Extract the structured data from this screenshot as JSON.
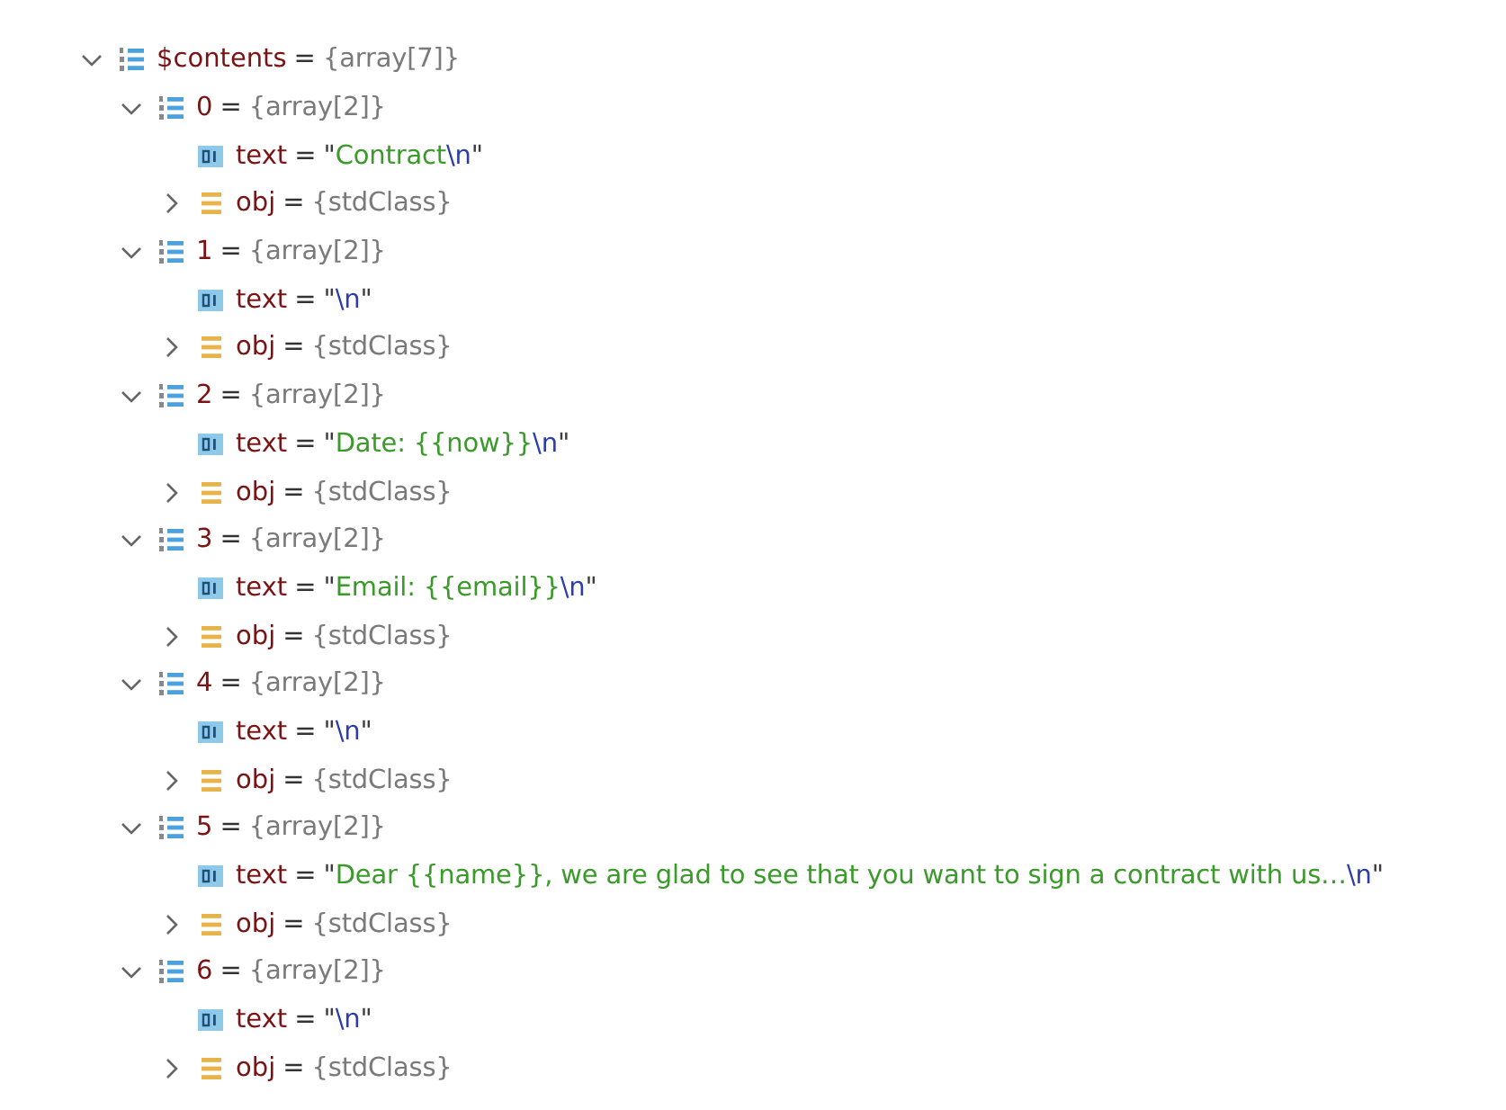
{
  "tree": [
    {
      "name": "$contents",
      "kind": "array",
      "op": "=",
      "expanded": true,
      "value": [
        {
          "kind": "summary",
          "text": "{array[7]}"
        }
      ],
      "children": [
        {
          "name": "0",
          "kind": "array",
          "op": "=",
          "expanded": true,
          "value": [
            {
              "kind": "summary",
              "text": "{array[2]}"
            }
          ],
          "children": [
            {
              "name": "text",
              "kind": "scalar",
              "op": "=",
              "value": [
                {
                  "kind": "quote",
                  "text": "\""
                },
                {
                  "kind": "string",
                  "text": "Contract"
                },
                {
                  "kind": "escape",
                  "text": "\\n"
                },
                {
                  "kind": "quote",
                  "text": "\""
                }
              ]
            },
            {
              "name": "obj",
              "kind": "object",
              "op": "=",
              "expanded": false,
              "value": [
                {
                  "kind": "summary",
                  "text": "{stdClass}"
                }
              ]
            }
          ]
        },
        {
          "name": "1",
          "kind": "array",
          "op": "=",
          "expanded": true,
          "value": [
            {
              "kind": "summary",
              "text": "{array[2]}"
            }
          ],
          "children": [
            {
              "name": "text",
              "kind": "scalar",
              "op": "=",
              "value": [
                {
                  "kind": "quote",
                  "text": "\""
                },
                {
                  "kind": "escape",
                  "text": "\\n"
                },
                {
                  "kind": "quote",
                  "text": "\""
                }
              ]
            },
            {
              "name": "obj",
              "kind": "object",
              "op": "=",
              "expanded": false,
              "value": [
                {
                  "kind": "summary",
                  "text": "{stdClass}"
                }
              ]
            }
          ]
        },
        {
          "name": "2",
          "kind": "array",
          "op": "=",
          "expanded": true,
          "value": [
            {
              "kind": "summary",
              "text": "{array[2]}"
            }
          ],
          "children": [
            {
              "name": "text",
              "kind": "scalar",
              "op": "=",
              "value": [
                {
                  "kind": "quote",
                  "text": "\""
                },
                {
                  "kind": "string",
                  "text": "Date: {{now}}"
                },
                {
                  "kind": "escape",
                  "text": "\\n"
                },
                {
                  "kind": "quote",
                  "text": "\""
                }
              ]
            },
            {
              "name": "obj",
              "kind": "object",
              "op": "=",
              "expanded": false,
              "value": [
                {
                  "kind": "summary",
                  "text": "{stdClass}"
                }
              ]
            }
          ]
        },
        {
          "name": "3",
          "kind": "array",
          "op": "=",
          "expanded": true,
          "value": [
            {
              "kind": "summary",
              "text": "{array[2]}"
            }
          ],
          "children": [
            {
              "name": "text",
              "kind": "scalar",
              "op": "=",
              "value": [
                {
                  "kind": "quote",
                  "text": "\""
                },
                {
                  "kind": "string",
                  "text": "Email: {{email}}"
                },
                {
                  "kind": "escape",
                  "text": "\\n"
                },
                {
                  "kind": "quote",
                  "text": "\""
                }
              ]
            },
            {
              "name": "obj",
              "kind": "object",
              "op": "=",
              "expanded": false,
              "value": [
                {
                  "kind": "summary",
                  "text": "{stdClass}"
                }
              ]
            }
          ]
        },
        {
          "name": "4",
          "kind": "array",
          "op": "=",
          "expanded": true,
          "value": [
            {
              "kind": "summary",
              "text": "{array[2]}"
            }
          ],
          "children": [
            {
              "name": "text",
              "kind": "scalar",
              "op": "=",
              "value": [
                {
                  "kind": "quote",
                  "text": "\""
                },
                {
                  "kind": "escape",
                  "text": "\\n"
                },
                {
                  "kind": "quote",
                  "text": "\""
                }
              ]
            },
            {
              "name": "obj",
              "kind": "object",
              "op": "=",
              "expanded": false,
              "value": [
                {
                  "kind": "summary",
                  "text": "{stdClass}"
                }
              ]
            }
          ]
        },
        {
          "name": "5",
          "kind": "array",
          "op": "=",
          "expanded": true,
          "value": [
            {
              "kind": "summary",
              "text": "{array[2]}"
            }
          ],
          "children": [
            {
              "name": "text",
              "kind": "scalar",
              "op": "=",
              "value": [
                {
                  "kind": "quote",
                  "text": "\""
                },
                {
                  "kind": "string",
                  "text": "Dear {{name}}, we are glad to see that you want to sign a contract with us…"
                },
                {
                  "kind": "escape",
                  "text": "\\n"
                },
                {
                  "kind": "quote",
                  "text": "\""
                }
              ]
            },
            {
              "name": "obj",
              "kind": "object",
              "op": "=",
              "expanded": false,
              "value": [
                {
                  "kind": "summary",
                  "text": "{stdClass}"
                }
              ]
            }
          ]
        },
        {
          "name": "6",
          "kind": "array",
          "op": "=",
          "expanded": true,
          "value": [
            {
              "kind": "summary",
              "text": "{array[2]}"
            }
          ],
          "children": [
            {
              "name": "text",
              "kind": "scalar",
              "op": "=",
              "value": [
                {
                  "kind": "quote",
                  "text": "\""
                },
                {
                  "kind": "escape",
                  "text": "\\n"
                },
                {
                  "kind": "quote",
                  "text": "\""
                }
              ]
            },
            {
              "name": "obj",
              "kind": "object",
              "op": "=",
              "expanded": false,
              "value": [
                {
                  "kind": "summary",
                  "text": "{stdClass}"
                }
              ]
            }
          ]
        }
      ]
    }
  ]
}
